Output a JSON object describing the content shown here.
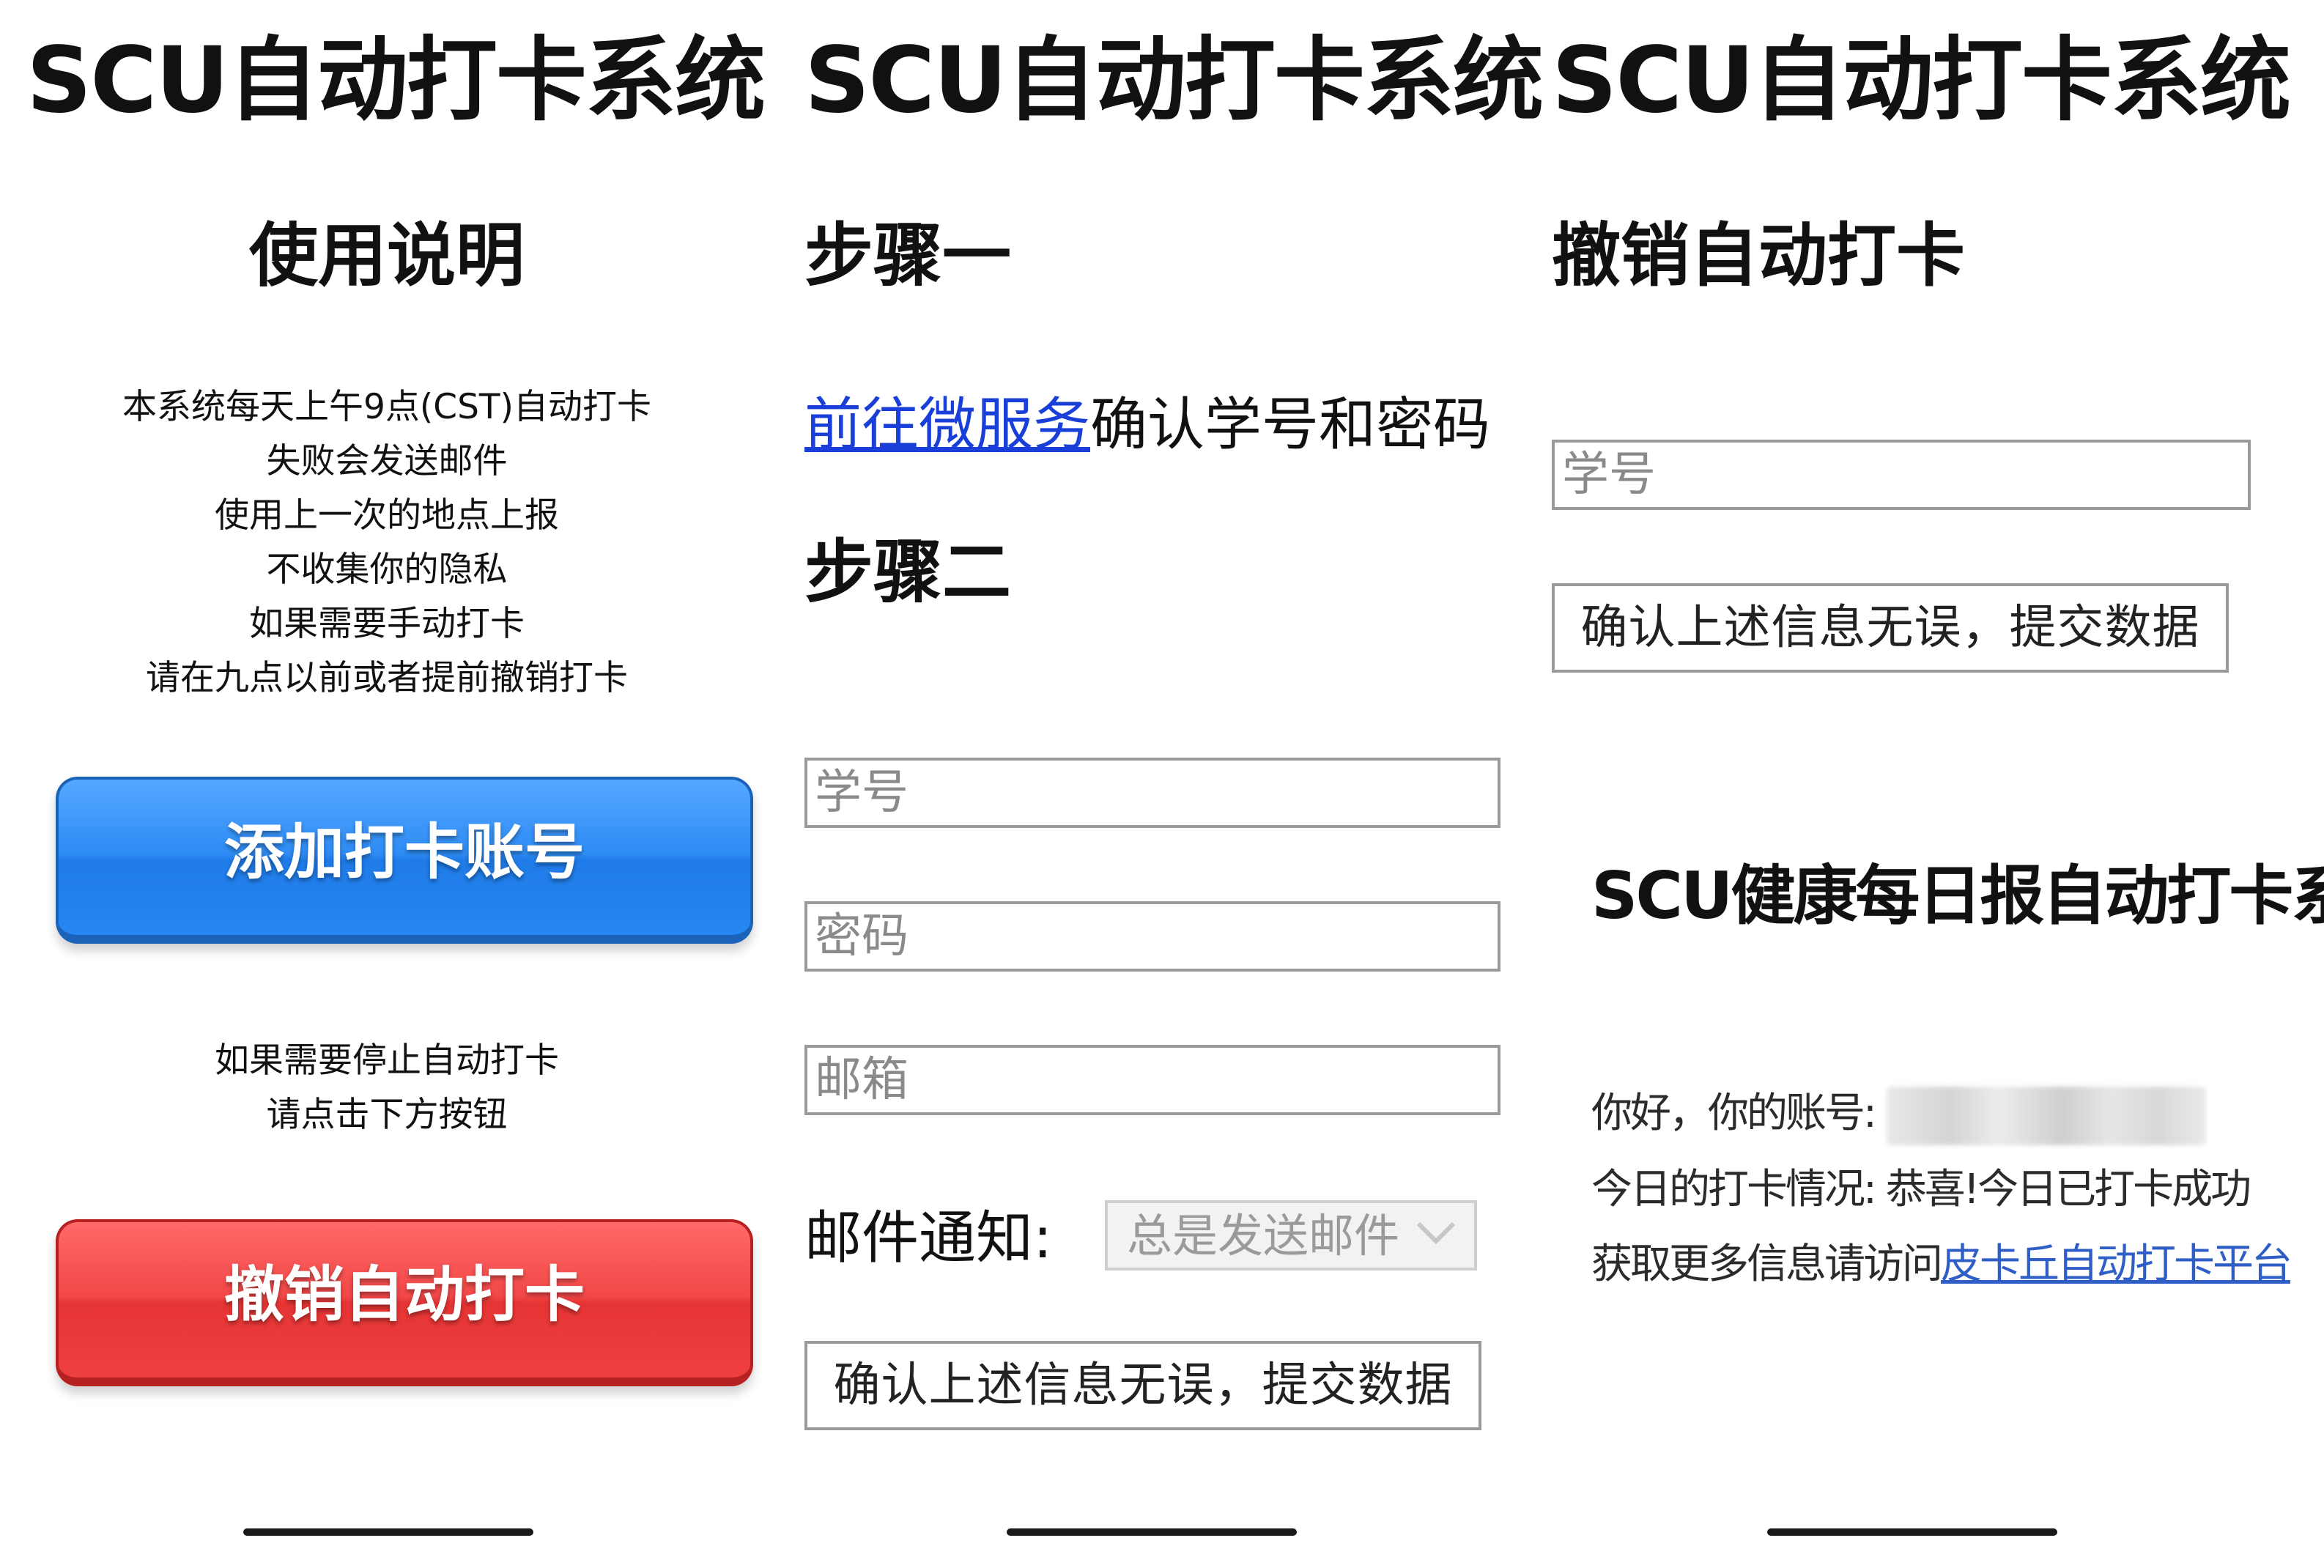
{
  "app_title": "SCU自动打卡系统",
  "panel1": {
    "heading": "使用说明",
    "instructions": [
      "本系统每天上午9点(CST)自动打卡",
      "失败会发送邮件",
      "使用上一次的地点上报",
      "不收集你的隐私",
      "如果需要手动打卡",
      "请在九点以前或者提前撤销打卡"
    ],
    "add_button_label": "添加打卡账号",
    "stop_hint": [
      "如果需要停止自动打卡",
      "请点击下方按钮"
    ],
    "revoke_button_label": "撤销自动打卡",
    "colors": {
      "add_button": "#2e8cf5",
      "revoke_button": "#f24747"
    }
  },
  "panel2": {
    "step1_heading": "步骤一",
    "step1_link": "前往微服务",
    "step1_text": "确认学号和密码",
    "step2_heading": "步骤二",
    "student_id_placeholder": "学号",
    "password_placeholder": "密码",
    "email_placeholder": "邮箱",
    "notify_label": "邮件通知:",
    "notify_selected": "总是发送邮件",
    "submit_label": "确认上述信息无误，提交数据",
    "colors": {
      "link": "#1a3fd8"
    }
  },
  "panel3": {
    "heading": "撤销自动打卡",
    "student_id_placeholder": "学号",
    "submit_label": "确认上述信息无误，提交数据",
    "email_preview": {
      "title": "SCU健康每日报自动打卡系统",
      "greeting": "你好，你的账号:",
      "status_prefix": "今日的打卡情况:",
      "status_value": "恭喜!今日已打卡成功",
      "more_info_prefix": "获取更多信息请访问",
      "more_info_link": "皮卡丘自动打卡平台"
    }
  }
}
